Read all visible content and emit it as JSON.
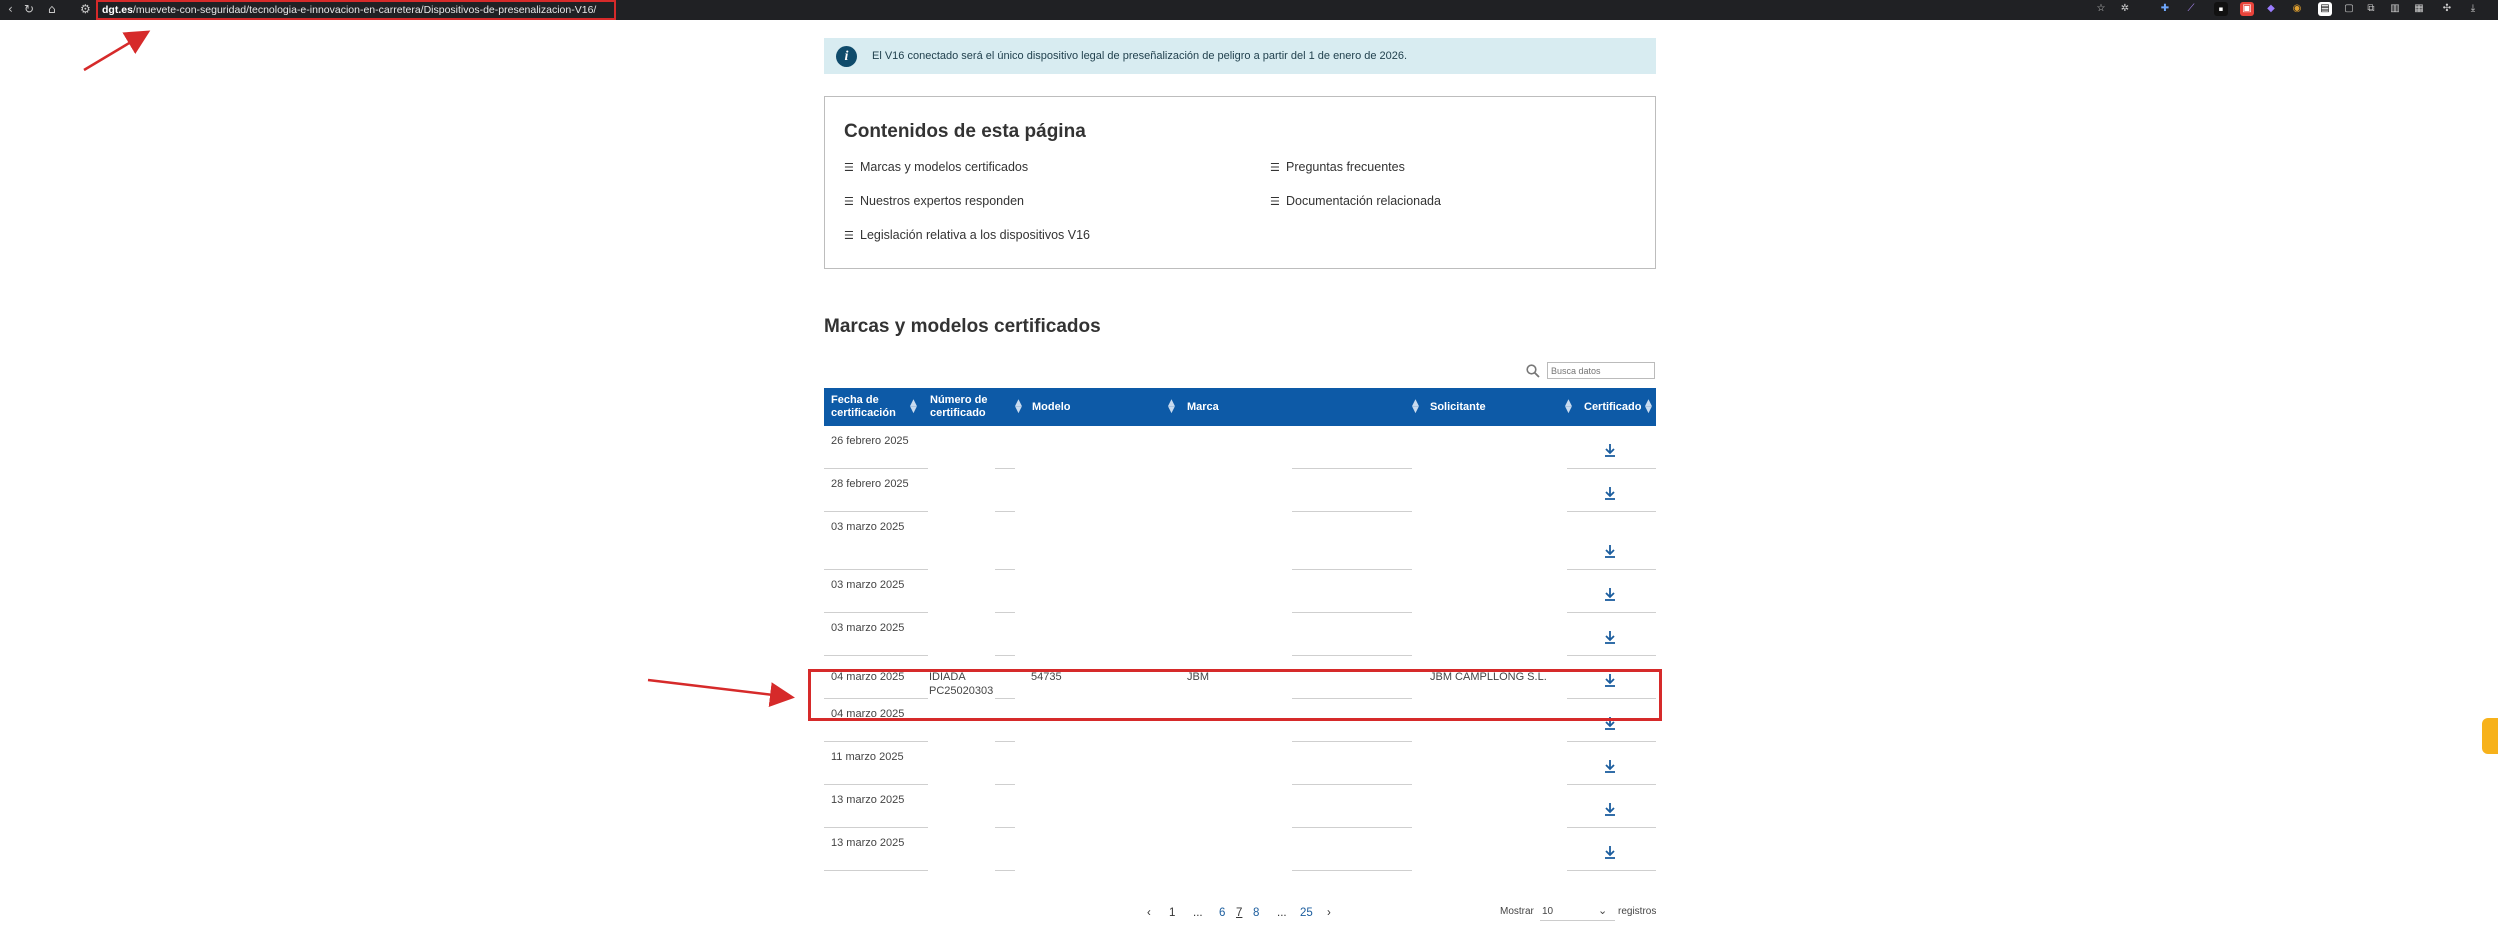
{
  "browser": {
    "url_domain": "dgt.es",
    "url_path": "/muevete-con-seguridad/tecnologia-e-innovacion-en-carretera/Dispositivos-de-presenalizacion-V16/",
    "nav_icons": [
      "reload-icon",
      "home-icon",
      "site-settings-icon"
    ],
    "extension_icons": [
      "bookmark-star-icon",
      "extension-icon",
      "extension-icon",
      "extension-icon",
      "extension-icon",
      "extension-icon",
      "extension-icon",
      "extension-icon",
      "extension-icon",
      "extension-icon",
      "extension-icon",
      "extension-icon",
      "download-icon",
      "star-icon"
    ]
  },
  "info_banner": {
    "icon": "info-icon",
    "text": "El V16 conectado será el único dispositivo legal de preseñalización de peligro a partir del 1 de enero de 2026."
  },
  "contents": {
    "title": "Contenidos de esta página",
    "items": [
      "Marcas y modelos certificados",
      "Preguntas frecuentes",
      "Nuestros expertos responden",
      "Documentación relacionada",
      "Legislación relativa a los dispositivos V16"
    ]
  },
  "section_title": "Marcas y modelos certificados",
  "search": {
    "placeholder": "Busca datos"
  },
  "table": {
    "headers": [
      "Fecha de certificación",
      "Número de certificado",
      "Modelo",
      "Marca",
      "Solicitante",
      "Certificado"
    ],
    "rows": [
      {
        "fecha": "26 febrero 2025",
        "numero": "",
        "modelo": "",
        "marca": "",
        "solicitante": ""
      },
      {
        "fecha": "28 febrero 2025",
        "numero": "",
        "modelo": "",
        "marca": "",
        "solicitante": ""
      },
      {
        "fecha": "03 marzo 2025",
        "numero": "",
        "modelo": "",
        "marca": "",
        "solicitante": ""
      },
      {
        "fecha": "03 marzo 2025",
        "numero": "",
        "modelo": "",
        "marca": "",
        "solicitante": ""
      },
      {
        "fecha": "03 marzo 2025",
        "numero": "",
        "modelo": "",
        "marca": "",
        "solicitante": ""
      },
      {
        "fecha": "04 marzo 2025",
        "numero": "IDIADA PC25020303",
        "modelo": "54735",
        "marca": "JBM",
        "solicitante": "JBM CAMPLLONG S.L."
      },
      {
        "fecha": "04 marzo 2025",
        "numero": "",
        "modelo": "",
        "marca": "",
        "solicitante": ""
      },
      {
        "fecha": "11 marzo 2025",
        "numero": "",
        "modelo": "",
        "marca": "",
        "solicitante": ""
      },
      {
        "fecha": "13 marzo 2025",
        "numero": "",
        "modelo": "",
        "marca": "",
        "solicitante": ""
      },
      {
        "fecha": "13 marzo 2025",
        "numero": "",
        "modelo": "",
        "marca": "",
        "solicitante": ""
      }
    ]
  },
  "pagination": {
    "prev": "‹",
    "pages": [
      "1",
      "...",
      "6",
      "7",
      "8",
      "...",
      "25"
    ],
    "next": "›",
    "current": "7"
  },
  "page_length": {
    "label_before": "Mostrar",
    "value": "10",
    "label_after": "registros"
  }
}
